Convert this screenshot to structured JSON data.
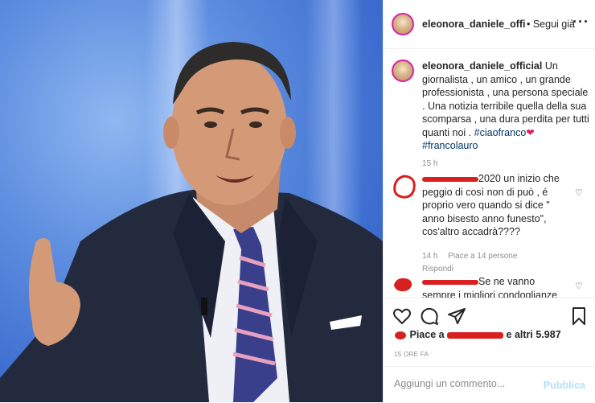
{
  "header": {
    "username": "eleonora_daniele_official",
    "follow": "• Segui già",
    "more_icon": "more-horizontal-icon"
  },
  "caption": {
    "username": "eleonora_daniele_official",
    "text": "Un giornalista , un amico , un grande professionista , una persona speciale . Una notizia terribile quella della sua scomparsa , una dura perdita per tutti quanti noi .",
    "hashtag1": "#ciaofranco",
    "hashtag2": "#francolauro",
    "time": "15 h",
    "emoji": "❤"
  },
  "comments": [
    {
      "text": "2020 un inizio che peggio di così non di può , é proprio vero quando si dice \" anno bisesto anno funesto\", cos'altro accadrà????",
      "time": "14 h",
      "likes": "Piace a 14 persone",
      "reply": "Rispondi"
    },
    {
      "text": "Se ne vanno sempre i migliori condoglianze"
    }
  ],
  "actions": {
    "like_icon": "heart-icon",
    "comment_icon": "comment-icon",
    "share_icon": "share-icon",
    "save_icon": "bookmark-icon"
  },
  "likes": {
    "prefix": "Piace a",
    "suffix": "e altri 5.987"
  },
  "posted_ago": "15 ORE FA",
  "add_comment": {
    "placeholder": "Aggiungi un commento...",
    "publish": "Pubblica"
  },
  "colors": {
    "accent_blue": "#0095f6",
    "hashtag": "#00376b",
    "redaction": "#d82020"
  }
}
